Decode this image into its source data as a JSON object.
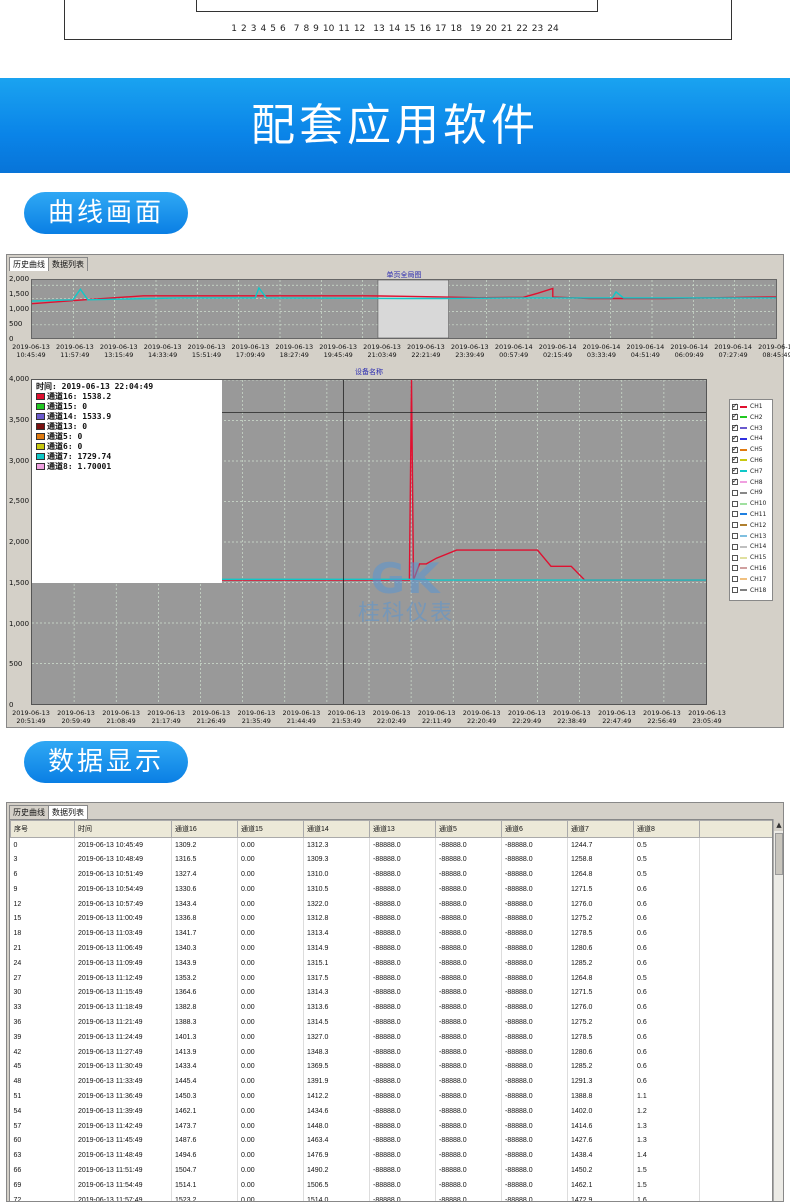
{
  "connector": {
    "pins": [
      "1",
      "2",
      "3",
      "4",
      "5",
      "6",
      "7",
      "8",
      "9",
      "10",
      "11",
      "12",
      "13",
      "14",
      "15",
      "16",
      "17",
      "18",
      "19",
      "20",
      "21",
      "22",
      "23",
      "24"
    ]
  },
  "banner": {
    "title": "配套应用软件"
  },
  "section1": {
    "label": "曲线画面"
  },
  "section2": {
    "label": "数据显示"
  },
  "win1": {
    "tabs": [
      "历史曲线",
      "数据列表"
    ],
    "overview_title": "单页全局图",
    "main_title": "设备名称",
    "overview_y": [
      "2,000",
      "1,500",
      "1,000",
      "500",
      "0"
    ],
    "overview_x": [
      [
        "2019-06-13",
        "10:45:49"
      ],
      [
        "2019-06-13",
        "11:57:49"
      ],
      [
        "2019-06-13",
        "13:15:49"
      ],
      [
        "2019-06-13",
        "14:33:49"
      ],
      [
        "2019-06-13",
        "15:51:49"
      ],
      [
        "2019-06-13",
        "17:09:49"
      ],
      [
        "2019-06-13",
        "18:27:49"
      ],
      [
        "2019-06-13",
        "19:45:49"
      ],
      [
        "2019-06-13",
        "21:03:49"
      ],
      [
        "2019-06-13",
        "22:21:49"
      ],
      [
        "2019-06-13",
        "23:39:49"
      ],
      [
        "2019-06-14",
        "00:57:49"
      ],
      [
        "2019-06-14",
        "02:15:49"
      ],
      [
        "2019-06-14",
        "03:33:49"
      ],
      [
        "2019-06-14",
        "04:51:49"
      ],
      [
        "2019-06-14",
        "06:09:49"
      ],
      [
        "2019-06-14",
        "07:27:49"
      ],
      [
        "2019-06-14",
        "08:45:49"
      ]
    ],
    "main_y": [
      "4,000",
      "3,500",
      "3,000",
      "2,500",
      "2,000",
      "1,500",
      "1,000",
      "500",
      "0"
    ],
    "main_x": [
      [
        "2019-06-13",
        "20:51:49"
      ],
      [
        "2019-06-13",
        "20:59:49"
      ],
      [
        "2019-06-13",
        "21:08:49"
      ],
      [
        "2019-06-13",
        "21:17:49"
      ],
      [
        "2019-06-13",
        "21:26:49"
      ],
      [
        "2019-06-13",
        "21:35:49"
      ],
      [
        "2019-06-13",
        "21:44:49"
      ],
      [
        "2019-06-13",
        "21:53:49"
      ],
      [
        "2019-06-13",
        "22:02:49"
      ],
      [
        "2019-06-13",
        "22:11:49"
      ],
      [
        "2019-06-13",
        "22:20:49"
      ],
      [
        "2019-06-13",
        "22:29:49"
      ],
      [
        "2019-06-13",
        "22:38:49"
      ],
      [
        "2019-06-13",
        "22:47:49"
      ],
      [
        "2019-06-13",
        "22:56:49"
      ],
      [
        "2019-06-13",
        "23:05:49"
      ]
    ],
    "legend": {
      "time": "时间: 2019-06-13 22:04:49",
      "rows": [
        {
          "text": "通道16: 1538.2",
          "color": "#e01030"
        },
        {
          "text": "通道15: 0",
          "color": "#22c822"
        },
        {
          "text": "通道14: 1533.9",
          "color": "#6a5acd"
        },
        {
          "text": "通道13: 0",
          "color": "#7a1010"
        },
        {
          "text": "通道5: 0",
          "color": "#e07a10"
        },
        {
          "text": "通道6: 0",
          "color": "#c8c810"
        },
        {
          "text": "通道7: 1729.74",
          "color": "#10c8c8"
        },
        {
          "text": "通道8: 1.70001",
          "color": "#f0a0e0"
        }
      ]
    },
    "channels": [
      {
        "name": "CH1",
        "on": true,
        "color": "#e01030"
      },
      {
        "name": "CH2",
        "on": true,
        "color": "#22c822"
      },
      {
        "name": "CH3",
        "on": true,
        "color": "#6a5acd"
      },
      {
        "name": "CH4",
        "on": true,
        "color": "#3030e0"
      },
      {
        "name": "CH5",
        "on": true,
        "color": "#e07a10"
      },
      {
        "name": "CH6",
        "on": true,
        "color": "#c8c810"
      },
      {
        "name": "CH7",
        "on": true,
        "color": "#10c8c8"
      },
      {
        "name": "CH8",
        "on": true,
        "color": "#f0a0e0"
      },
      {
        "name": "CH9",
        "on": false,
        "color": "#888888"
      },
      {
        "name": "CH10",
        "on": false,
        "color": "#a0e0a0"
      },
      {
        "name": "CH11",
        "on": false,
        "color": "#2080e0"
      },
      {
        "name": "CH12",
        "on": false,
        "color": "#b08030"
      },
      {
        "name": "CH13",
        "on": false,
        "color": "#80c0e0"
      },
      {
        "name": "CH14",
        "on": false,
        "color": "#c0c0c0"
      },
      {
        "name": "CH15",
        "on": false,
        "color": "#e0e0a0"
      },
      {
        "name": "CH16",
        "on": false,
        "color": "#d0a0a0"
      },
      {
        "name": "CH17",
        "on": false,
        "color": "#f0c080"
      },
      {
        "name": "CH18",
        "on": false,
        "color": "#808080"
      }
    ],
    "watermark": {
      "logo": "GK",
      "name": "桂科仪表"
    }
  },
  "chart_data": [
    {
      "type": "line",
      "title": "单页全局图",
      "ylim": [
        0,
        2200
      ],
      "yticks": [
        0,
        500,
        1000,
        1500,
        2000
      ],
      "series": [
        {
          "color": "#e01030",
          "x": [
            0,
            0.07,
            0.15,
            0.3,
            0.45,
            0.5,
            0.55,
            0.6,
            0.66,
            0.68,
            0.7,
            0.7,
            0.75,
            0.85,
            1.0
          ],
          "y": [
            1300,
            1450,
            1600,
            1600,
            1600,
            1580,
            1560,
            1530,
            1540,
            1700,
            1880,
            1550,
            1500,
            1500,
            1560
          ]
        },
        {
          "color": "#10c8c8",
          "x": [
            0,
            0.055,
            0.065,
            0.075,
            0.2,
            0.3,
            0.305,
            0.315,
            0.5,
            0.55,
            0.65,
            0.78,
            0.785,
            0.795,
            1.0
          ],
          "y": [
            1400,
            1450,
            1850,
            1450,
            1520,
            1520,
            1900,
            1520,
            1500,
            1500,
            1520,
            1520,
            1750,
            1520,
            1520
          ]
        }
      ],
      "highlight": [
        0.465,
        0.56
      ]
    },
    {
      "type": "line",
      "title": "设备名称",
      "ylim": [
        0,
        4000
      ],
      "yticks": [
        0,
        500,
        1000,
        1500,
        2000,
        2500,
        3000,
        3500,
        4000
      ],
      "series": [
        {
          "color": "#e01030",
          "x": [
            0,
            0.55,
            0.56,
            0.563,
            0.566,
            0.575,
            0.585,
            0.6,
            0.63,
            0.7,
            0.75,
            0.77,
            0.8,
            0.82,
            0.87,
            1.0
          ],
          "y": [
            1530,
            1530,
            1530,
            4000,
            1530,
            1730,
            1730,
            1800,
            1900,
            1900,
            1900,
            1700,
            1700,
            1530,
            1530,
            1530
          ]
        },
        {
          "color": "#10c8c8",
          "x": [
            0,
            0.57,
            0.6,
            1.0
          ],
          "y": [
            1540,
            1540,
            1530,
            1530
          ]
        }
      ],
      "cursor": {
        "x": 0.462,
        "y": 3600
      }
    }
  ],
  "win2": {
    "tabs": [
      "历史曲线",
      "数据列表"
    ],
    "columns": [
      "序号",
      "时间",
      "通道16",
      "通道15",
      "通道14",
      "通道13",
      "通道5",
      "通道6",
      "通道7",
      "通道8"
    ],
    "rows": [
      [
        "0",
        "2019-06-13 10:45:49",
        "1309.2",
        "0.00",
        "1312.3",
        "-88888.0",
        "-88888.0",
        "-88888.0",
        "1244.7",
        "0.5"
      ],
      [
        "3",
        "2019-06-13 10:48:49",
        "1316.5",
        "0.00",
        "1309.3",
        "-88888.0",
        "-88888.0",
        "-88888.0",
        "1258.8",
        "0.5"
      ],
      [
        "6",
        "2019-06-13 10:51:49",
        "1327.4",
        "0.00",
        "1310.0",
        "-88888.0",
        "-88888.0",
        "-88888.0",
        "1264.8",
        "0.5"
      ],
      [
        "9",
        "2019-06-13 10:54:49",
        "1330.6",
        "0.00",
        "1310.5",
        "-88888.0",
        "-88888.0",
        "-88888.0",
        "1271.5",
        "0.6"
      ],
      [
        "12",
        "2019-06-13 10:57:49",
        "1343.4",
        "0.00",
        "1322.0",
        "-88888.0",
        "-88888.0",
        "-88888.0",
        "1276.0",
        "0.6"
      ],
      [
        "15",
        "2019-06-13 11:00:49",
        "1336.8",
        "0.00",
        "1312.8",
        "-88888.0",
        "-88888.0",
        "-88888.0",
        "1275.2",
        "0.6"
      ],
      [
        "18",
        "2019-06-13 11:03:49",
        "1341.7",
        "0.00",
        "1313.4",
        "-88888.0",
        "-88888.0",
        "-88888.0",
        "1278.5",
        "0.6"
      ],
      [
        "21",
        "2019-06-13 11:06:49",
        "1340.3",
        "0.00",
        "1314.9",
        "-88888.0",
        "-88888.0",
        "-88888.0",
        "1280.6",
        "0.6"
      ],
      [
        "24",
        "2019-06-13 11:09:49",
        "1343.9",
        "0.00",
        "1315.1",
        "-88888.0",
        "-88888.0",
        "-88888.0",
        "1285.2",
        "0.6"
      ],
      [
        "27",
        "2019-06-13 11:12:49",
        "1353.2",
        "0.00",
        "1317.5",
        "-88888.0",
        "-88888.0",
        "-88888.0",
        "1264.8",
        "0.5"
      ],
      [
        "30",
        "2019-06-13 11:15:49",
        "1364.6",
        "0.00",
        "1314.3",
        "-88888.0",
        "-88888.0",
        "-88888.0",
        "1271.5",
        "0.6"
      ],
      [
        "33",
        "2019-06-13 11:18:49",
        "1382.8",
        "0.00",
        "1313.6",
        "-88888.0",
        "-88888.0",
        "-88888.0",
        "1276.0",
        "0.6"
      ],
      [
        "36",
        "2019-06-13 11:21:49",
        "1388.3",
        "0.00",
        "1314.5",
        "-88888.0",
        "-88888.0",
        "-88888.0",
        "1275.2",
        "0.6"
      ],
      [
        "39",
        "2019-06-13 11:24:49",
        "1401.3",
        "0.00",
        "1327.0",
        "-88888.0",
        "-88888.0",
        "-88888.0",
        "1278.5",
        "0.6"
      ],
      [
        "42",
        "2019-06-13 11:27:49",
        "1413.9",
        "0.00",
        "1348.3",
        "-88888.0",
        "-88888.0",
        "-88888.0",
        "1280.6",
        "0.6"
      ],
      [
        "45",
        "2019-06-13 11:30:49",
        "1433.4",
        "0.00",
        "1369.5",
        "-88888.0",
        "-88888.0",
        "-88888.0",
        "1285.2",
        "0.6"
      ],
      [
        "48",
        "2019-06-13 11:33:49",
        "1445.4",
        "0.00",
        "1391.9",
        "-88888.0",
        "-88888.0",
        "-88888.0",
        "1291.3",
        "0.6"
      ],
      [
        "51",
        "2019-06-13 11:36:49",
        "1450.3",
        "0.00",
        "1412.2",
        "-88888.0",
        "-88888.0",
        "-88888.0",
        "1388.8",
        "1.1"
      ],
      [
        "54",
        "2019-06-13 11:39:49",
        "1462.1",
        "0.00",
        "1434.6",
        "-88888.0",
        "-88888.0",
        "-88888.0",
        "1402.0",
        "1.2"
      ],
      [
        "57",
        "2019-06-13 11:42:49",
        "1473.7",
        "0.00",
        "1448.0",
        "-88888.0",
        "-88888.0",
        "-88888.0",
        "1414.6",
        "1.3"
      ],
      [
        "60",
        "2019-06-13 11:45:49",
        "1487.6",
        "0.00",
        "1463.4",
        "-88888.0",
        "-88888.0",
        "-88888.0",
        "1427.6",
        "1.3"
      ],
      [
        "63",
        "2019-06-13 11:48:49",
        "1494.6",
        "0.00",
        "1476.9",
        "-88888.0",
        "-88888.0",
        "-88888.0",
        "1438.4",
        "1.4"
      ],
      [
        "66",
        "2019-06-13 11:51:49",
        "1504.7",
        "0.00",
        "1490.2",
        "-88888.0",
        "-88888.0",
        "-88888.0",
        "1450.2",
        "1.5"
      ],
      [
        "69",
        "2019-06-13 11:54:49",
        "1514.1",
        "0.00",
        "1506.5",
        "-88888.0",
        "-88888.0",
        "-88888.0",
        "1462.1",
        "1.5"
      ],
      [
        "72",
        "2019-06-13 11:57:49",
        "1523.2",
        "0.00",
        "1514.0",
        "-88888.0",
        "-88888.0",
        "-88888.0",
        "1472.9",
        "1.6"
      ]
    ]
  }
}
